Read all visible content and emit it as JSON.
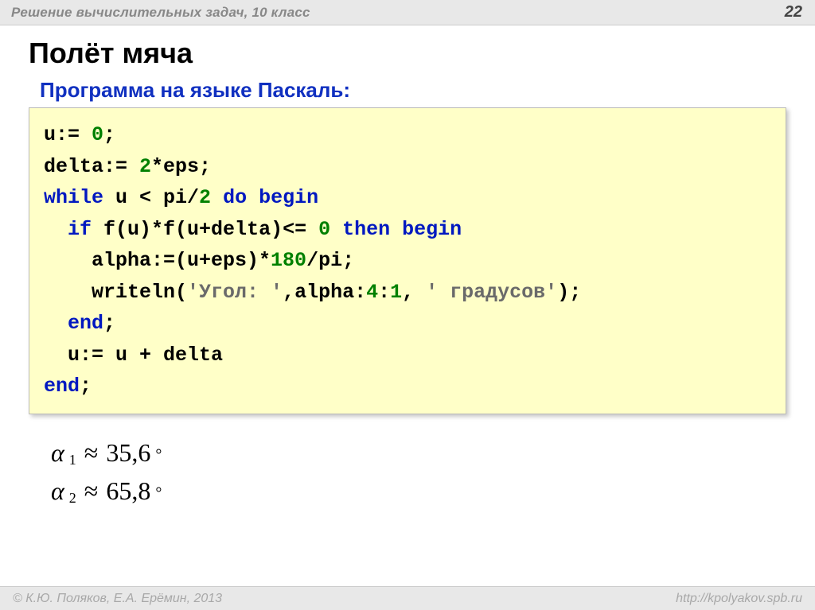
{
  "header": {
    "title": "Решение  вычислительных задач, 10 класс",
    "page": "22"
  },
  "slide": {
    "title": "Полёт мяча",
    "subtitle": "Программа на языке Паскаль:"
  },
  "code": {
    "l1a": "u:= ",
    "l1n": "0",
    "l1b": ";",
    "l2a": "delta:= ",
    "l2n": "2",
    "l2b": "*eps;",
    "l3a": "while",
    "l3b": " u < pi/",
    "l3n": "2",
    "l3c": " ",
    "l3d": "do begin",
    "l4a": "  ",
    "l4k": "if",
    "l4b": " f(u)*f(u+delta)<= ",
    "l4n": "0",
    "l4c": " ",
    "l4d": "then begin",
    "l5a": "    alpha:=(u+eps)*",
    "l5n": "180",
    "l5b": "/pi;",
    "l6a": "    writeln(",
    "l6s1": "'Угол: '",
    "l6b": ",alpha:",
    "l6n1": "4",
    "l6c": ":",
    "l6n2": "1",
    "l6d": ", ",
    "l6s2": "' градусов'",
    "l6e": ");",
    "l7a": "  ",
    "l7k": "end",
    "l7b": ";",
    "l8": "  u:= u + delta",
    "l9a": "end",
    "l9b": ";"
  },
  "results": {
    "r1_sym": "α",
    "r1_sub": "1",
    "r1_approx": "≈",
    "r1_val": "35,6",
    "r1_deg": "°",
    "r2_sym": "α",
    "r2_sub": "2",
    "r2_approx": "≈",
    "r2_val": "65,8",
    "r2_deg": "°"
  },
  "footer": {
    "left": "© К.Ю. Поляков, Е.А. Ерёмин, 2013",
    "right": "http://kpolyakov.spb.ru"
  }
}
